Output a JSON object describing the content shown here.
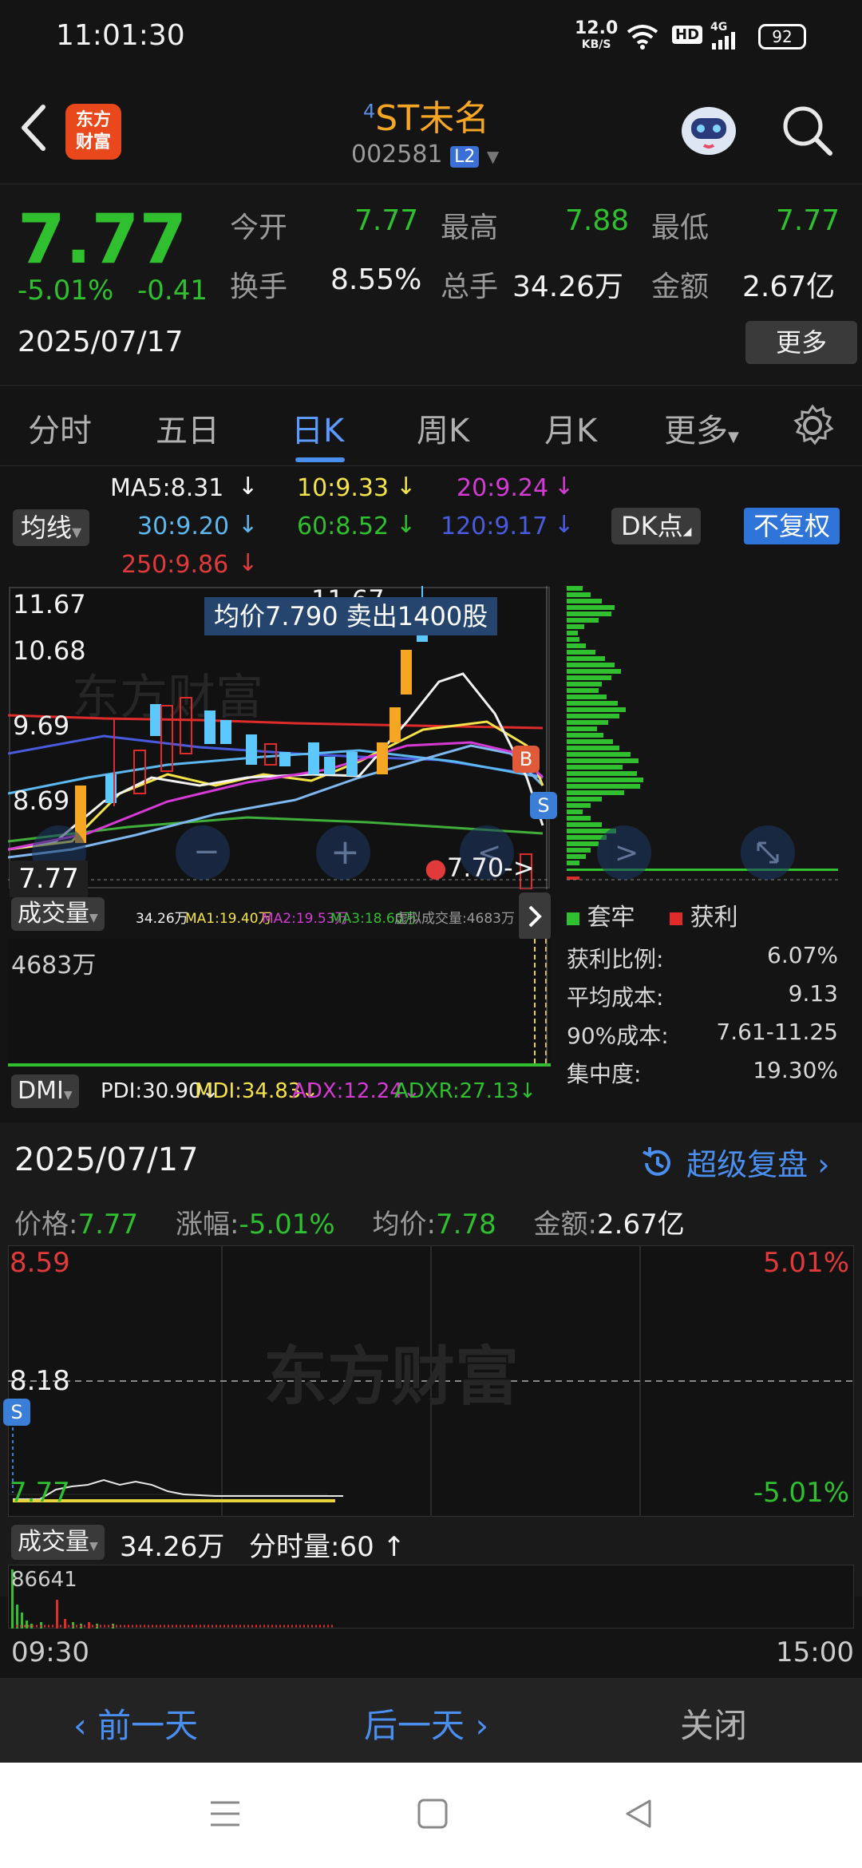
{
  "status_bar": {
    "time": "11:01:30",
    "net_speed": "12.0",
    "net_unit": "KB/S",
    "hd": "HD",
    "signal": "4G",
    "battery": "92"
  },
  "header": {
    "logo_line1": "东方",
    "logo_line2": "财富",
    "title_sup": "4",
    "title": "ST未名",
    "code": "002581",
    "level": "L2"
  },
  "quote": {
    "price": "7.77",
    "change_pct": "-5.01%",
    "change": "-0.41",
    "date": "2025/07/17",
    "open_label": "今开",
    "open": "7.77",
    "high_label": "最高",
    "high": "7.88",
    "low_label": "最低",
    "low": "7.77",
    "turnover_label": "换手",
    "turnover": "8.55%",
    "volume_label": "总手",
    "volume": "34.26万",
    "amount_label": "金额",
    "amount": "2.67亿",
    "more": "更多"
  },
  "tabs": [
    "分时",
    "五日",
    "日K",
    "周K",
    "月K",
    "更多"
  ],
  "active_tab": "日K",
  "ma": {
    "selector": "均线",
    "ma5": "MA5:8.31",
    "ma10": "10:9.33",
    "ma20": "20:9.24",
    "ma30": "30:9.20",
    "ma60": "60:8.52",
    "ma120": "120:9.17",
    "ma250": "250:9.86",
    "dk": "DK点",
    "adjust": "不复权"
  },
  "kchart": {
    "y1": "11.67",
    "y2": "10.68",
    "y3": "9.69",
    "y4": "8.69",
    "peak_label": "11.67",
    "tooltip": "均价7.790  卖出1400股",
    "current": "7.77",
    "marker": "7.70->",
    "b_badge": "B",
    "s_badge": "S"
  },
  "volume_bar": {
    "selector": "成交量",
    "v": "34.26万",
    "ma1": "MA1:19.40万",
    "ma2": "MA2:19.53万",
    "ma3": "MA3:18.60万",
    "virtual": "虚拟成交量:4683万",
    "y": "4683万"
  },
  "dmi": {
    "selector": "DMI",
    "pdi": "PDI:30.90",
    "mdi": "MDI:34.83",
    "adx": "ADX:12.24",
    "adxr": "ADXR:27.13"
  },
  "chip": {
    "trapped": "套牢",
    "profit": "获利",
    "rows": [
      {
        "label": "获利比例:",
        "value": "6.07%"
      },
      {
        "label": "平均成本:",
        "value": "9.13"
      },
      {
        "label": "90%成本:",
        "value": "7.61-11.25"
      },
      {
        "label": "集中度:",
        "value": "19.30%"
      }
    ]
  },
  "replay": {
    "date": "2025/07/17",
    "link": "超级复盘",
    "price_label": "价格:",
    "price": "7.77",
    "chg_label": "涨幅:",
    "chg": "-5.01%",
    "avg_label": "均价:",
    "avg": "7.78",
    "amt_label": "金额:",
    "amt": "2.67亿"
  },
  "intraday": {
    "top_price": "8.59",
    "top_pct": "5.01%",
    "mid_price": "8.18",
    "bottom_price": "7.77",
    "bottom_pct": "-5.01%",
    "s_badge": "S",
    "watermark": "东方财富",
    "vol_selector": "成交量",
    "vol": "34.26万",
    "vol_per_min": "分时量:60",
    "vol_y": "86641",
    "time_start": "09:30",
    "time_end": "15:00"
  },
  "bottom_actions": {
    "prev": "前一天",
    "next": "后一天",
    "close": "关闭"
  }
}
